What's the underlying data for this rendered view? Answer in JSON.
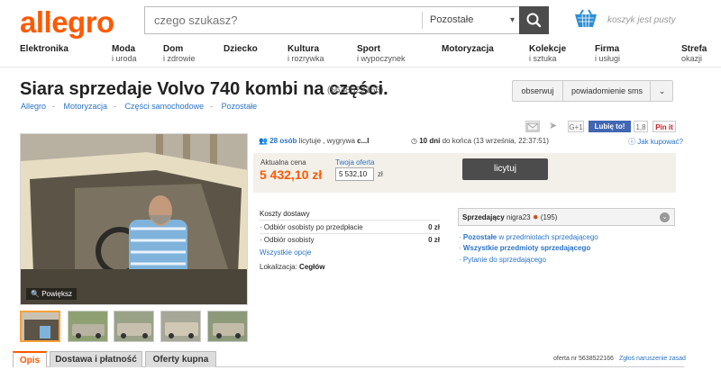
{
  "header": {
    "logo": "allegro",
    "search_placeholder": "czego szukasz?",
    "search_category": "Pozostałe",
    "basket_text": "koszyk jest pusty"
  },
  "nav": [
    {
      "title": "Elektronika",
      "sub": ""
    },
    {
      "title": "Moda",
      "sub": "i uroda"
    },
    {
      "title": "Dom",
      "sub": "i zdrowie"
    },
    {
      "title": "Dziecko",
      "sub": ""
    },
    {
      "title": "Kultura",
      "sub": "i rozrywka"
    },
    {
      "title": "Sport",
      "sub": "i wypoczynek"
    },
    {
      "title": "Motoryzacja",
      "sub": ""
    },
    {
      "title": "Kolekcje",
      "sub": "i sztuka"
    },
    {
      "title": "Firma",
      "sub": "i usługi"
    },
    {
      "title": "Strefa",
      "sub": "okazji"
    }
  ],
  "offer": {
    "title": "Siara sprzedaje Volvo 740 kombi na części.",
    "id_text": "(5638522166)",
    "watch_label": "obserwuj",
    "notify_label": "powiadomienie sms",
    "breadcrumbs": [
      "Allegro",
      "Motoryzacja",
      "Części samochodowe",
      "Pozostałe"
    ]
  },
  "social": {
    "google": "G+1",
    "like": "Lubię to!",
    "like_count": "1,8",
    "pinit": "Pin it"
  },
  "help_link": "Jak kupować?",
  "gallery": {
    "enlarge_label": "Powiększ"
  },
  "auction": {
    "bidders_count": "28 osób",
    "bidders_text": "licytuje , wygrywa",
    "bidders_user": "c...l",
    "time_left": "10 dni",
    "time_text": "do końca (13 września, 22:37:51)",
    "price_label": "Aktualna cena",
    "price": "5 432,10 zł",
    "your_offer_label": "Twoja oferta",
    "your_offer_value": "5 532,10",
    "currency": "zł",
    "bid_button": "licytuj"
  },
  "shipping": {
    "title": "Koszty dostawy",
    "rows": [
      {
        "label": "Odbiór osobisty po przedpłacie",
        "value": "0 zł"
      },
      {
        "label": "Odbiór osobisty",
        "value": "0 zł"
      }
    ],
    "more_link": "Wszystkie opcje",
    "location_label": "Lokalizacja:",
    "location": "Cegłów"
  },
  "seller": {
    "label": "Sprzedający",
    "name": "nigra23",
    "rating": "(195)",
    "links": [
      {
        "bold": "Pozostałe",
        "rest": " w przedmiotach sprzedającego"
      },
      {
        "bold": "Wszystkie przedmioty sprzedającego",
        "rest": ""
      },
      {
        "bold": "",
        "rest": "Pytanie do sprzedającego"
      }
    ]
  },
  "tabs": [
    "Opis",
    "Dostawa i płatność",
    "Oferty kupna"
  ],
  "footer": {
    "offer_no": "oferta nr 5638522166",
    "report": "Zgłoś naruszenie zasad"
  },
  "colors": {
    "brand": "#ff5a00",
    "link": "#2a73c5",
    "button": "#4c4c4c"
  }
}
